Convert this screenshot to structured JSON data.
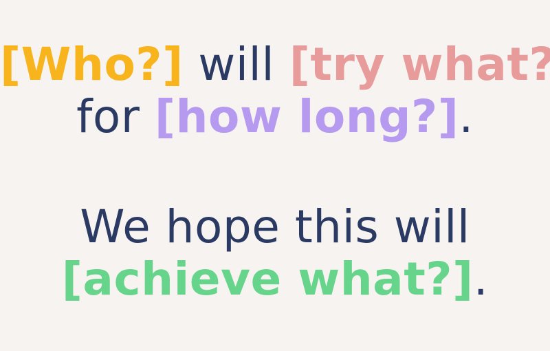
{
  "template": {
    "line1": {
      "who": "[Who?]",
      "will": " will ",
      "try_what": "[try what?]"
    },
    "line2": {
      "for": "for ",
      "how_long": "[how long?]",
      "period": "."
    },
    "line3": {
      "text": "We hope this will"
    },
    "line4": {
      "achieve_what": "[achieve what?]",
      "period": "."
    }
  },
  "colors": {
    "background": "#f7f3f1",
    "text": "#2b3a62",
    "who": "#f7b41c",
    "try_what": "#e89b9b",
    "how_long": "#b59af0",
    "achieve_what": "#67d48c"
  }
}
